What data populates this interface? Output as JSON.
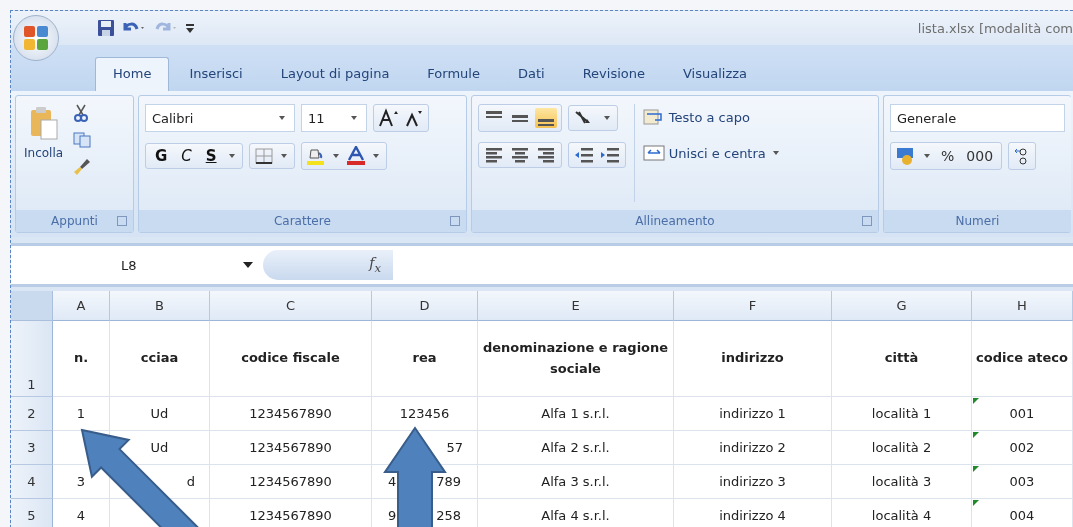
{
  "window": {
    "title": "lista.xlsx [modalità com"
  },
  "quick_access": {
    "undo_enabled": true,
    "redo_enabled": false
  },
  "tabs": [
    {
      "label": "Home",
      "selected": true
    },
    {
      "label": "Inserisci",
      "selected": false
    },
    {
      "label": "Layout di pagina",
      "selected": false
    },
    {
      "label": "Formule",
      "selected": false
    },
    {
      "label": "Dati",
      "selected": false
    },
    {
      "label": "Revisione",
      "selected": false
    },
    {
      "label": "Visualizza",
      "selected": false
    }
  ],
  "ribbon": {
    "clipboard": {
      "label": "Appunti",
      "paste": "Incolla"
    },
    "font": {
      "label": "Carattere",
      "font_name": "Calibri",
      "font_size": "11",
      "styles": [
        "G",
        "C",
        "S"
      ]
    },
    "alignment": {
      "label": "Allineamento",
      "vertical": [
        {
          "selected": false
        },
        {
          "selected": false
        },
        {
          "selected": true
        }
      ],
      "wrap_text": "Testo a capo",
      "merge_center": "Unisci e centra"
    },
    "number": {
      "label": "Numeri",
      "format": "Generale",
      "percent": "%",
      "thousands": "000"
    }
  },
  "formula_bar": {
    "name_box": "L8",
    "function_button": "f$_{x}$"
  },
  "sheet": {
    "columns": [
      "A",
      "B",
      "C",
      "D",
      "E",
      "F",
      "G",
      "H"
    ],
    "header_row": {
      "number": "1",
      "cells": [
        "n.",
        "cciaa",
        "codice fiscale",
        "rea",
        "denominazione e ragione sociale",
        "indirizzo",
        "città",
        "codice ateco"
      ]
    },
    "rows": [
      {
        "number": "2",
        "flagged": true,
        "cells": [
          "1",
          "Ud",
          "1234567890",
          "123456",
          "Alfa 1 s.r.l.",
          "indirizzo 1",
          "località 1",
          "001"
        ]
      },
      {
        "number": "3",
        "flagged": true,
        "cells": [
          null,
          "Ud",
          "1234567890",
          {
            "text": "57",
            "hidden_left": true
          },
          "Alfa 2 s.r.l.",
          "indirizzo 2",
          "località 2",
          "002"
        ]
      },
      {
        "number": "4",
        "flagged": true,
        "cells": [
          "3",
          {
            "text": "d",
            "hidden_left": true
          },
          "1234567890",
          {
            "parts": [
              "4",
              "789"
            ]
          },
          "Alfa 3 s.r.l.",
          "indirizzo 3",
          "località 3",
          "003"
        ]
      },
      {
        "number": "5",
        "flagged": true,
        "cells": [
          "4",
          null,
          "1234567890",
          {
            "parts": [
              "9",
              "258"
            ]
          },
          "Alfa 4 s.r.l.",
          "indirizzo 4",
          "località 4",
          "004"
        ]
      }
    ]
  }
}
